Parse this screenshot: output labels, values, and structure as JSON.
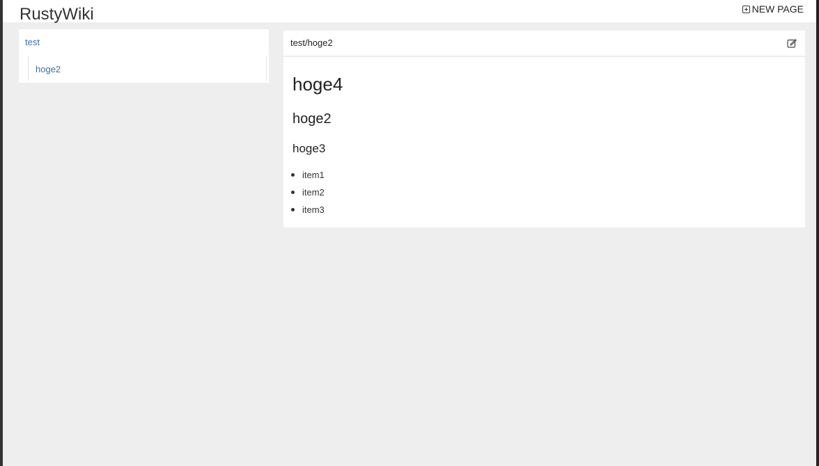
{
  "header": {
    "app_title": "RustyWiki",
    "new_page_label": "NEW PAGE",
    "new_page_icon": "plus-box-icon"
  },
  "sidebar": {
    "root": {
      "label": "test"
    },
    "children": [
      {
        "label": "hoge2"
      }
    ]
  },
  "page": {
    "path": "test/hoge2",
    "edit_icon": "edit-icon",
    "headings": [
      "hoge4",
      "hoge2",
      "hoge3"
    ],
    "items": [
      "item1",
      "item2",
      "item3"
    ]
  }
}
